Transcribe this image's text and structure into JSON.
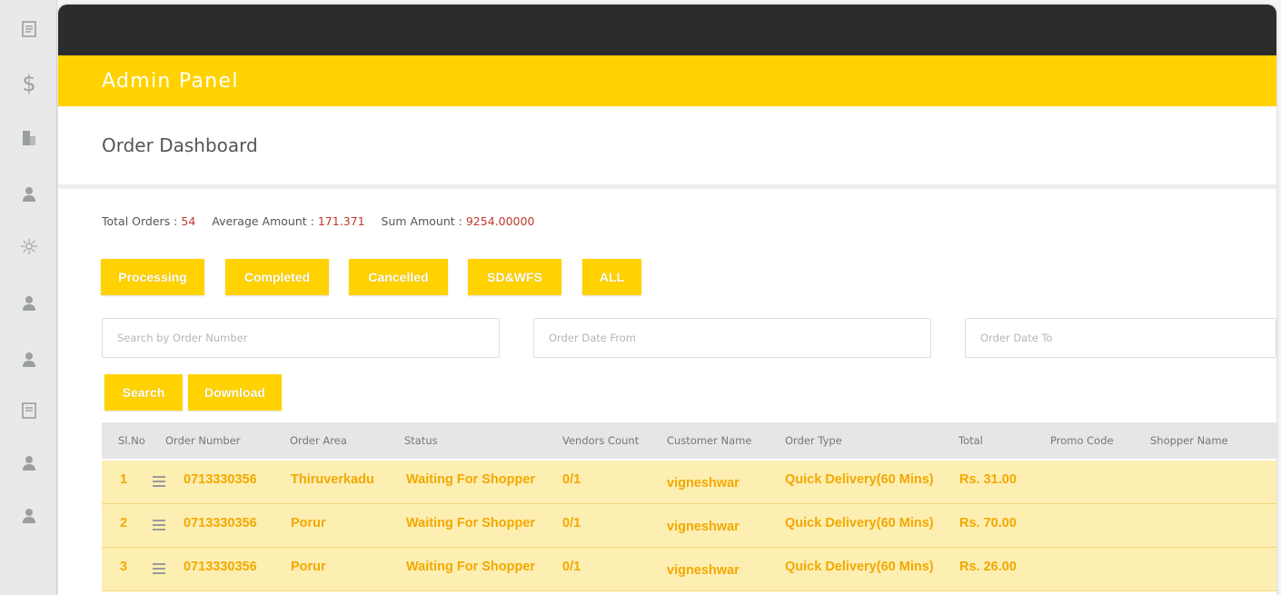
{
  "app": {
    "brand": "Admin Panel",
    "page_title": "Order Dashboard"
  },
  "sidebar": {
    "icons": [
      "document-icon",
      "dollar-icon",
      "building-icon",
      "user-icon",
      "gear-icon",
      "user-icon",
      "user-icon",
      "document-icon",
      "user-icon",
      "user-icon"
    ]
  },
  "stats": {
    "total_orders_label": "Total Orders :",
    "total_orders_value": "54",
    "average_amount_label": "Average Amount :",
    "average_amount_value": "171.371",
    "sum_amount_label": "Sum Amount :",
    "sum_amount_value": "9254.00000"
  },
  "filters": {
    "processing": "Processing",
    "completed": "Completed",
    "cancelled": "Cancelled",
    "sdwfs": "SD&WFS",
    "all": "ALL"
  },
  "search": {
    "order_number_placeholder": "Search by Order Number",
    "date_from_placeholder": "Order Date From",
    "date_to_placeholder": "Order Date To",
    "search_label": "Search",
    "download_label": "Download"
  },
  "table": {
    "headers": {
      "sl_no": "Sl.No",
      "order_number": "Order Number",
      "order_area": "Order Area",
      "status": "Status",
      "vendors_count": "Vendors Count",
      "customer_name": "Customer Name",
      "order_type": "Order Type",
      "total": "Total",
      "promo_code": "Promo Code",
      "shopper_name": "Shopper Name"
    },
    "rows": [
      {
        "sl": "1",
        "order_number": "0713330356",
        "area": "Thiruverkadu",
        "status": "Waiting For Shopper",
        "vendors": "0/1",
        "customer": "vigneshwar",
        "type": "Quick Delivery(60 Mins)",
        "total": "Rs. 31.00"
      },
      {
        "sl": "2",
        "order_number": "0713330356",
        "area": "Porur",
        "status": "Waiting For Shopper",
        "vendors": "0/1",
        "customer": "vigneshwar",
        "type": "Quick Delivery(60 Mins)",
        "total": "Rs. 70.00"
      },
      {
        "sl": "3",
        "order_number": "0713330356",
        "area": "Porur",
        "status": "Waiting For Shopper",
        "vendors": "0/1",
        "customer": "vigneshwar",
        "type": "Quick Delivery(60 Mins)",
        "total": "Rs. 26.00"
      }
    ]
  },
  "colors": {
    "accent": "#ffd200",
    "topbar": "#2c2c2c",
    "row_bg": "#fdeeb2",
    "row_text": "#f2a900",
    "stat_value": "#c0392b"
  }
}
